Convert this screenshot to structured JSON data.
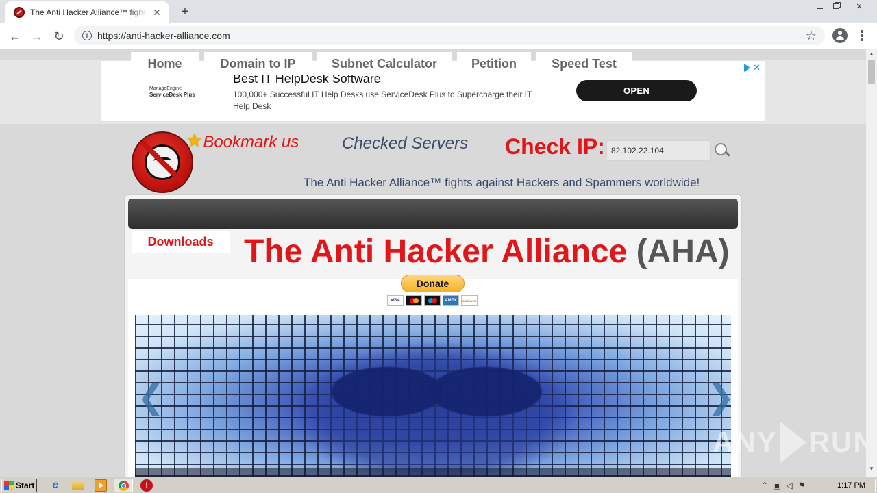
{
  "browser": {
    "tab_title": "The Anti Hacker Alliance™ fights against Hackers and Spammers worldwide!",
    "tab_close": "✕",
    "new_tab": "+",
    "url": "https://anti-hacker-alliance.com",
    "back": "←",
    "forward": "→",
    "reload": "↻",
    "star": "☆",
    "close_window": "✕"
  },
  "ad": {
    "brand_small": "ManageEngine",
    "brand": "ServiceDesk Plus",
    "title": "Best IT HelpDesk Software",
    "description": "100,000+ Successful IT Help Desks use ServiceDesk Plus to Supercharge their IT Help Desk",
    "cta": "OPEN",
    "close": "✕"
  },
  "header": {
    "bookmark": "Bookmark us",
    "checked_servers": "Checked Servers",
    "check_ip_label": "Check IP:",
    "ip_value": "82.102.22.104",
    "tagline": "The Anti Hacker Alliance™ fights against Hackers and Spammers worldwide!"
  },
  "nav": {
    "items": [
      {
        "label": "Home"
      },
      {
        "label": "Domain to IP"
      },
      {
        "label": "Subnet Calculator"
      },
      {
        "label": "Petition"
      },
      {
        "label": "Speed Test"
      }
    ],
    "downloads": "Downloads"
  },
  "main": {
    "title": "The Anti Hacker Alliance",
    "title_suffix": "(AHA)",
    "donate": "Donate",
    "cards": [
      "VISA",
      "",
      "",
      "AMEX",
      "DISCOVER"
    ],
    "prev": "❮",
    "next": "❯"
  },
  "watermark": {
    "left": "ANY",
    "right": "RUN"
  },
  "taskbar": {
    "start": "Start",
    "ie_glyph": "e",
    "stop_glyph": "!",
    "clock": "1:17 PM"
  }
}
